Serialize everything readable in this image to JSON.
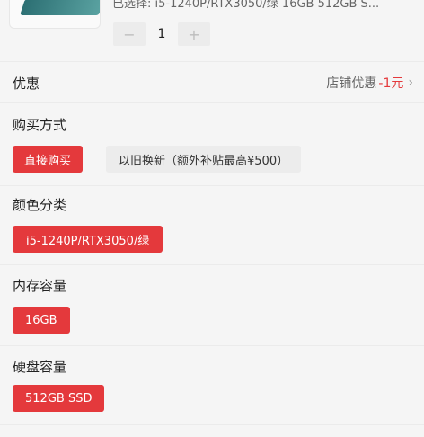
{
  "product": {
    "selected_text": "已选择: i5-1240P/RTX3050/绿 16GB 512GB S...",
    "quantity": "1",
    "minus_label": "−",
    "plus_label": "+"
  },
  "promo": {
    "title": "优惠",
    "shop_label": "店铺优惠",
    "shop_amount": "-1元",
    "chevron": "›"
  },
  "purchase": {
    "title": "购买方式",
    "options": [
      "直接购买",
      "以旧换新（额外补贴最高¥500）"
    ]
  },
  "color": {
    "title": "颜色分类",
    "options": [
      "i5-1240P/RTX3050/绿"
    ]
  },
  "memory": {
    "title": "内存容量",
    "options": [
      "16GB"
    ]
  },
  "storage": {
    "title": "硬盘容量",
    "options": [
      "512GB SSD"
    ]
  },
  "colors": {
    "accent": "#e4393c",
    "chip_off": "#ececec",
    "bg": "#f5f5f5"
  }
}
